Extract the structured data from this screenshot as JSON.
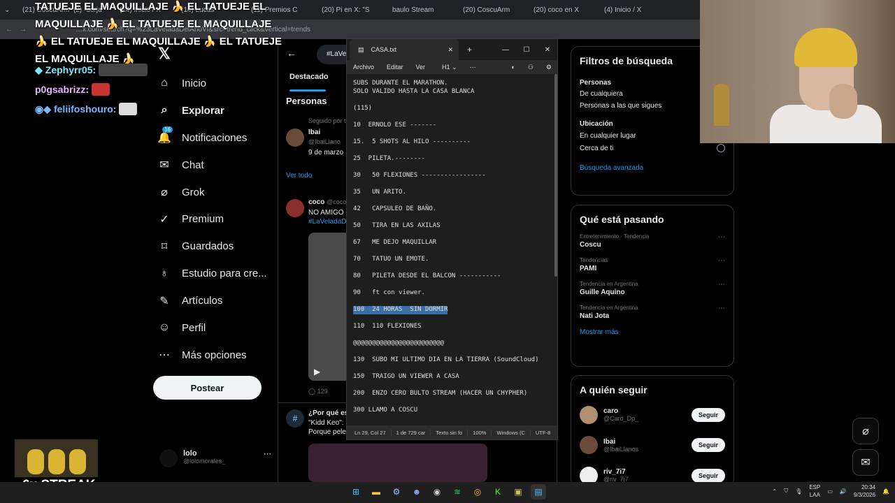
{
  "browser": {
    "tabs": [
      "(21) CoscuArm…",
      "(2) ·dorja",
      "(14) Inicio / X",
      "(14) Lucas",
      "(11) Premios C",
      "(20) Pi en X: \"S",
      "baulo Stream",
      "(20) CoscuArm",
      "(20) coco en X",
      "(4) Inicio / X"
    ],
    "url": "…x.com/search?q=%23LaVeladaDelAñoVI&src=trend_click&vertical=trends"
  },
  "overlay": {
    "repeat_lines": [
      "TATUEJE EL MAQUILLAJE 🍌 EL TATUEJE EL",
      "MAQUILLAJE 🍌 EL TATUEJE EL MAQUILLAJE",
      "🍌 EL TATUEJE EL MAQUILLAJE 🍌 EL TATUEJE",
      "EL MAQUILLAJE 🍌"
    ],
    "chat": [
      {
        "user": "Zephyrr05:"
      },
      {
        "user": "p0gsabrizz:"
      },
      {
        "user": "feliifoshouro:"
      }
    ],
    "streak": "6x STREAK"
  },
  "sidebar": {
    "logo": "𝕏",
    "items": [
      {
        "label": "Inicio",
        "icon": "home-icon",
        "glyph": "⌂"
      },
      {
        "label": "Explorar",
        "icon": "search-icon",
        "glyph": "⌕"
      },
      {
        "label": "Notificaciones",
        "icon": "bell-icon",
        "glyph": "🔔",
        "badge": "16"
      },
      {
        "label": "Chat",
        "icon": "mail-icon",
        "glyph": "✉"
      },
      {
        "label": "Grok",
        "icon": "grok-icon",
        "glyph": "⌀"
      },
      {
        "label": "Premium",
        "icon": "premium-icon",
        "glyph": "✓"
      },
      {
        "label": "Guardados",
        "icon": "bookmark-icon",
        "glyph": "⌑"
      },
      {
        "label": "Estudio para cre...",
        "icon": "studio-icon",
        "glyph": "♁"
      },
      {
        "label": "Artículos",
        "icon": "article-icon",
        "glyph": "✎"
      },
      {
        "label": "Perfil",
        "icon": "user-icon",
        "glyph": "☺"
      },
      {
        "label": "Más opciones",
        "icon": "more-icon",
        "glyph": "⋯"
      }
    ],
    "post_label": "Postear",
    "account": {
      "name": "lolo",
      "handle": "@lolomorales_"
    }
  },
  "feed": {
    "search_value": "#LaVe",
    "tab": "Destacado",
    "section": "Personas",
    "followed_by": "Seguido por t",
    "person": {
      "name": "Ibai",
      "handle": "@IbaiLlano",
      "date": "9 de marzo"
    },
    "see_all": "Ver todo",
    "tweet1": {
      "name": "coco",
      "handle": "@coco",
      "text": "NO AMIGO",
      "hashtag": "#LaVeladaD",
      "replies": "129"
    },
    "tweet2": {
      "title": "¿Por qué es",
      "line1": "\"Kidd Keo\":",
      "line2": "Porque pele"
    }
  },
  "notepad": {
    "file": "CASA.txt",
    "menu": [
      "Archivo",
      "Editar",
      "Ver"
    ],
    "heading": "H1",
    "lines": [
      "SUBS DURANTE EL MARATHON.",
      "SOLO VALIDO HASTA LA CASA BLANCA",
      "",
      "(115)",
      "",
      "10  ERNOLO ESE -------",
      "",
      "15.  5 SHOTS AL HILO ----------",
      "",
      "25  PILETA.--------",
      "",
      "30   50 FLEXIONES -----------------",
      "",
      "35   UN ARITO.",
      "",
      "42   CAPSULEO DE BAÑO.",
      "",
      "50   TIRA EN LAS AXILAS",
      "",
      "67   ME DEJO MAQUILLAR",
      "",
      "70   TATUO UN EMOTE.",
      "",
      "80   PILETA DESDE EL BALCON -----------",
      "",
      "90   ft con viewer.",
      "",
      "100  24 HORAS  SIN DORMIR",
      "",
      "110  110 FLEXIONES",
      "",
      "@@@@@@@@@@@@@@@@@@@@@@@@",
      "",
      "130  SUBO MI ULTIMO DIA EN LA TIERRA (SoundCloud)",
      "",
      "150  TRAIGO UN VIEWER A CASA",
      "",
      "200  ENZO CERO BULTO STREAM (HACER UN CHYPHER)",
      "",
      "300 LLAMO A COSCU"
    ],
    "status": [
      "Ln 29, Col 27",
      "1 de 729 car",
      "Texto sin fo",
      "100%",
      "Windows (C",
      "UTF-8"
    ]
  },
  "right": {
    "filters_title": "Filtros de búsqueda",
    "people_label": "Personas",
    "people_opts": [
      "De cualquiera",
      "Personas a las que sigues"
    ],
    "location_label": "Ubicación",
    "location_opts": [
      "En cualquier lugar",
      "Cerca de ti"
    ],
    "advanced": "Búsqueda avanzada",
    "trending_title": "Qué está pasando",
    "trends": [
      {
        "meta": "Entretenimiento · Tendencia",
        "name": "Coscu"
      },
      {
        "meta": "Tendencias",
        "name": "PAMI"
      },
      {
        "meta": "Tendencia en Argentina",
        "name": "Guille Aquino"
      },
      {
        "meta": "Tendencia en Argentina",
        "name": "Nati Jota"
      }
    ],
    "show_more": "Mostrar más",
    "who_title": "A quién seguir",
    "who": [
      {
        "name": "caro",
        "handle": "@Caro_Dp_"
      },
      {
        "name": "Ibai",
        "handle": "@IbaiLlanos"
      },
      {
        "name": "riv_7i7",
        "handle": "@riv_7i7"
      }
    ],
    "follow_label": "Seguir"
  },
  "taskbar": {
    "lang": [
      "ESP",
      "LAA"
    ],
    "time": "20:34",
    "date": "9/3/2026"
  }
}
